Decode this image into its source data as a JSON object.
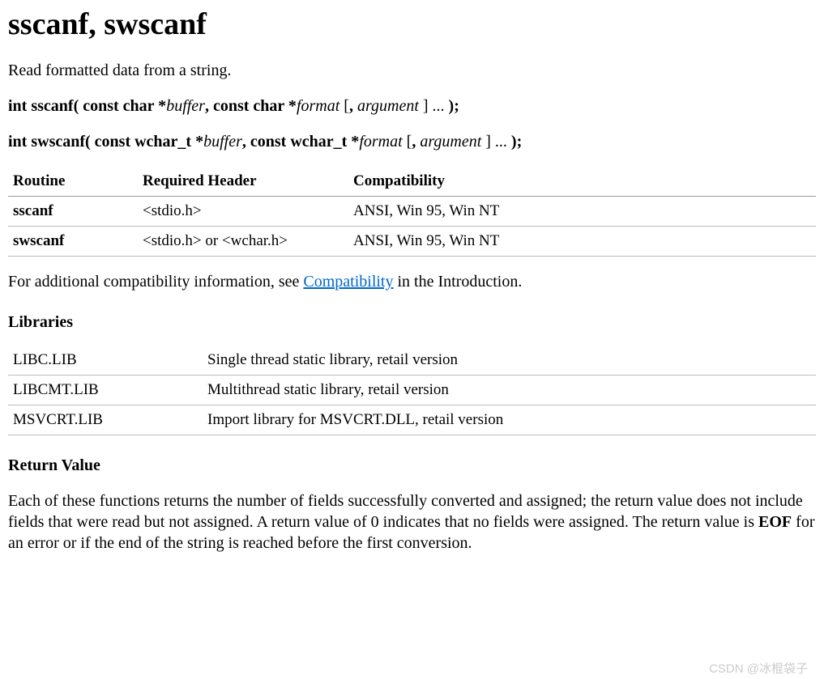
{
  "title": "sscanf, swscanf",
  "summary": "Read formatted data from a string.",
  "sig1": {
    "prefix": "int sscanf( const char *",
    "p1": "buffer",
    "mid1": ", const char *",
    "p2": "format",
    "opt_open": " [",
    "mid2": ", ",
    "p3": "argument",
    "opt_close": " ] ",
    "ell": "... ",
    "end": ");"
  },
  "sig2": {
    "prefix": "int swscanf( const wchar_t *",
    "p1": "buffer",
    "mid1": ", const wchar_t *",
    "p2": "format",
    "opt_open": " [",
    "mid2": ", ",
    "p3": "argument",
    "opt_close": " ] ",
    "ell": "... ",
    "end": ");"
  },
  "table1": {
    "headers": [
      "Routine",
      "Required Header",
      "Compatibility"
    ],
    "rows": [
      [
        "sscanf",
        "<stdio.h>",
        "ANSI, Win 95, Win NT"
      ],
      [
        "swscanf",
        "<stdio.h> or <wchar.h>",
        "ANSI, Win 95, Win NT"
      ]
    ]
  },
  "compat_text_pre": "For additional compatibility information, see ",
  "compat_link": "Compatibility",
  "compat_text_post": " in the Introduction.",
  "libraries_title": "Libraries",
  "table2": {
    "rows": [
      [
        "LIBC.LIB",
        "Single thread static library, retail version"
      ],
      [
        "LIBCMT.LIB",
        "Multithread static library, retail version"
      ],
      [
        "MSVCRT.LIB",
        "Import library for MSVCRT.DLL, retail version"
      ]
    ]
  },
  "return_title": "Return Value",
  "return_text_pre": "Each of these functions returns the number of fields successfully converted and assigned; the return value does not include fields that were read but not assigned. A return value of 0 indicates that no fields were assigned. The return value is ",
  "return_eof": "EOF",
  "return_text_post": " for an error or if the end of the string is reached before the first conversion.",
  "watermark": "CSDN @冰棍袋子"
}
